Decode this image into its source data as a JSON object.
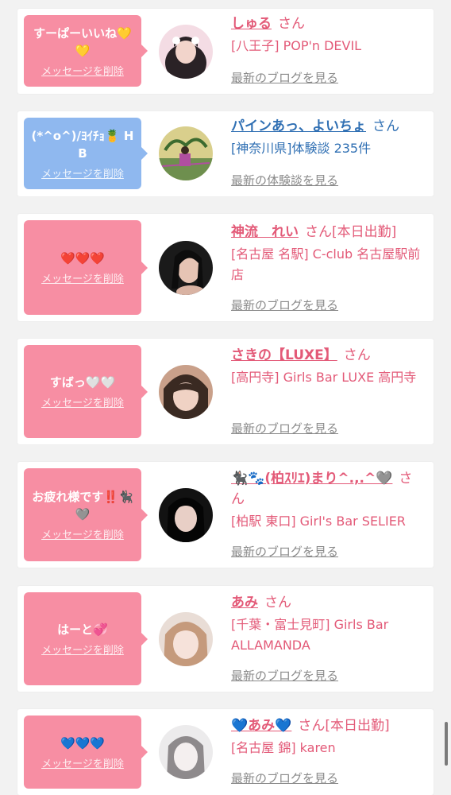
{
  "cards": [
    {
      "message": "すーぱーいいね💛💛",
      "delete_label": "メッセージを削除",
      "name": "しゅる",
      "san": "さん",
      "status": "",
      "shop": "[八王子] POP'n DEVIL",
      "link": "最新のブログを見る",
      "theme": "pink"
    },
    {
      "message": "(*^o^)/ﾖｲﾁｮ🍍 HB",
      "delete_label": "メッセージを削除",
      "name": "パインあっ、よいちょ",
      "san": "さん",
      "status": "",
      "shop": "[神奈川県]体験談 235件",
      "link": "最新の体験談を見る",
      "theme": "blue"
    },
    {
      "message": "❤️❤️❤️",
      "delete_label": "メッセージを削除",
      "name": "神流　れい",
      "san": "さん",
      "status": "[本日出勤]",
      "shop": "[名古屋 名駅] C-club 名古屋駅前店",
      "link": "最新のブログを見る",
      "theme": "pink"
    },
    {
      "message": "すばっ🤍🤍",
      "delete_label": "メッセージを削除",
      "name": "さきの【LUXE】",
      "san": "さん",
      "status": "",
      "shop": "[高円寺] Girls Bar LUXE 高円寺",
      "link": "最新のブログを見る",
      "theme": "pink"
    },
    {
      "message": "お疲れ様です‼️🐈‍⬛🩶",
      "delete_label": "メッセージを削除",
      "name": "🐈‍⬛🐾(柏ｽﾘｴ)まり^.,.^🩶",
      "san": "さん",
      "status": "",
      "shop": "[柏駅 東口] Girl's Bar SELIER",
      "link": "最新のブログを見る",
      "theme": "pink"
    },
    {
      "message": "はーと💞",
      "delete_label": "メッセージを削除",
      "name": "あみ",
      "san": "さん",
      "status": "",
      "shop": "[千葉・富士見町] Girls Bar ALLAMANDA",
      "link": "最新のブログを見る",
      "theme": "pink"
    },
    {
      "message": "💙💙💙",
      "delete_label": "メッセージを削除",
      "name": "💙あみ💙",
      "san": "さん",
      "status": "[本日出勤]",
      "shop": "[名古屋 錦] karen",
      "link": "最新のブログを見る",
      "theme": "pink"
    }
  ],
  "colors": {
    "pink_bubble": "#f78ea3",
    "blue_bubble": "#8fb8ef",
    "pink_text": "#e35a78",
    "blue_text": "#2f6fb3",
    "link_gray": "#8a8a8a",
    "background": "#f2f2f2"
  }
}
